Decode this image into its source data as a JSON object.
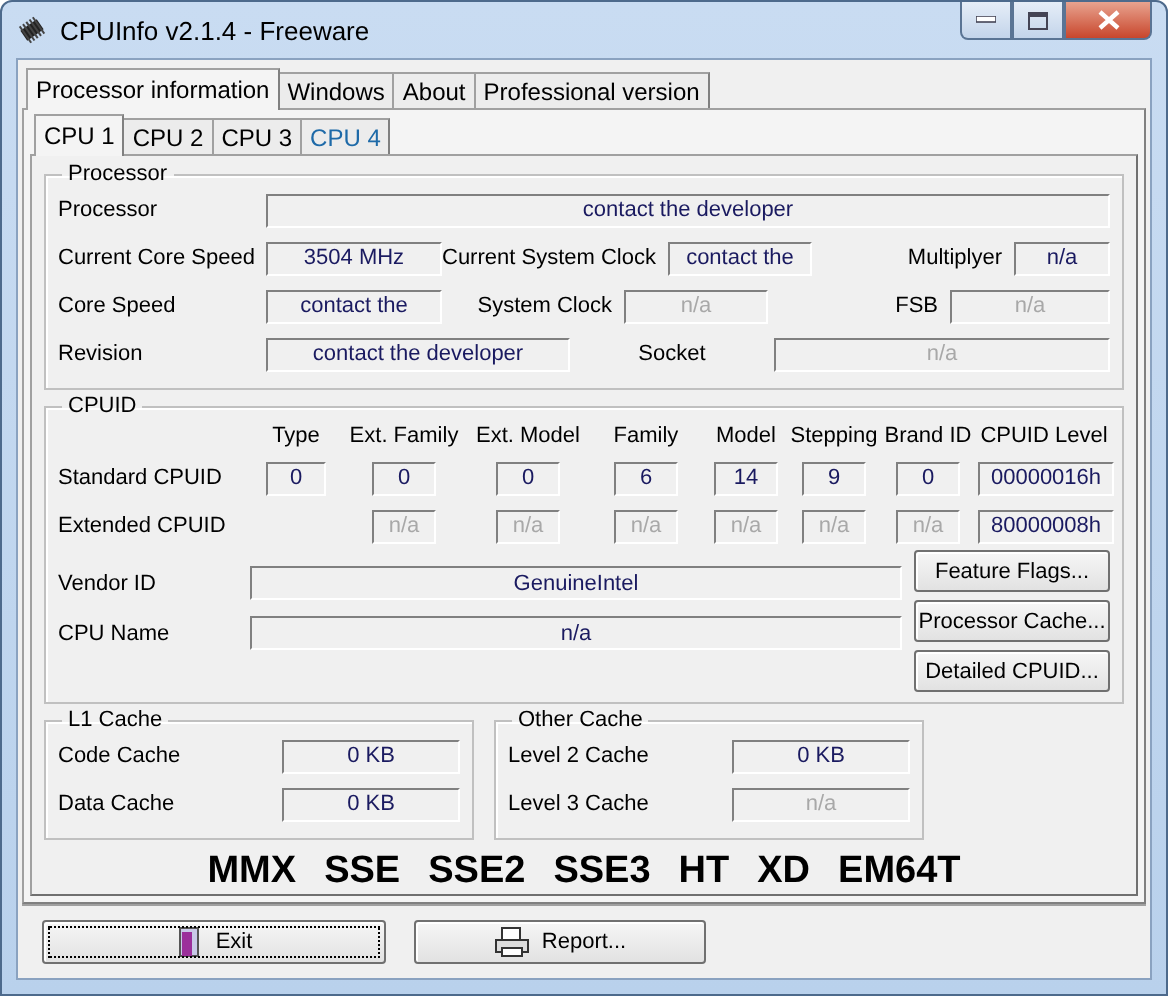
{
  "window": {
    "title": "CPUInfo v2.1.4 - Freeware"
  },
  "tabs": [
    {
      "label": "Processor information",
      "selected": true
    },
    {
      "label": "Windows",
      "selected": false
    },
    {
      "label": "About",
      "selected": false
    },
    {
      "label": "Professional version",
      "selected": false
    }
  ],
  "cpu_tabs": [
    {
      "label": "CPU 1",
      "selected": true,
      "hovered": false
    },
    {
      "label": "CPU 2",
      "selected": false,
      "hovered": false
    },
    {
      "label": "CPU 3",
      "selected": false,
      "hovered": false
    },
    {
      "label": "CPU 4",
      "selected": false,
      "hovered": true
    }
  ],
  "processor": {
    "title": "Processor",
    "rows": [
      [
        {
          "label": "Processor",
          "value": "contact the developer",
          "disabled": false
        }
      ],
      [
        {
          "label": "Current Core Speed",
          "value": "3504 MHz",
          "disabled": false
        },
        {
          "label": "Current System Clock",
          "value": "contact the",
          "disabled": false
        },
        {
          "label": "Multiplyer",
          "value": "n/a",
          "disabled": false
        }
      ],
      [
        {
          "label": "Core Speed",
          "value": "contact the",
          "disabled": false
        },
        {
          "label": "System Clock",
          "value": "n/a",
          "disabled": true
        },
        {
          "label": "FSB",
          "value": "n/a",
          "disabled": true
        }
      ],
      [
        {
          "label": "Revision",
          "value": "contact the developer",
          "disabled": false
        },
        {
          "label": "Socket",
          "value": "n/a",
          "disabled": true
        }
      ]
    ]
  },
  "cpuid": {
    "title": "CPUID",
    "columns": [
      "Type",
      "Ext. Family",
      "Ext. Model",
      "Family",
      "Model",
      "Stepping",
      "Brand ID",
      "CPUID Level"
    ],
    "rows": [
      {
        "label": "Standard CPUID",
        "values": [
          {
            "value": "0",
            "disabled": false
          },
          {
            "value": "0",
            "disabled": false
          },
          {
            "value": "0",
            "disabled": false
          },
          {
            "value": "6",
            "disabled": false
          },
          {
            "value": "14",
            "disabled": false
          },
          {
            "value": "9",
            "disabled": false
          },
          {
            "value": "0",
            "disabled": false
          },
          {
            "value": "00000016h",
            "disabled": false
          }
        ]
      },
      {
        "label": "Extended CPUID",
        "values": [
          {
            "value": "n/a",
            "disabled": true
          },
          {
            "value": "n/a",
            "disabled": true
          },
          {
            "value": "n/a",
            "disabled": true
          },
          {
            "value": "n/a",
            "disabled": true
          },
          {
            "value": "n/a",
            "disabled": true
          },
          {
            "value": "n/a",
            "disabled": true
          },
          {
            "value": "80000008h",
            "disabled": false
          }
        ]
      }
    ],
    "fields": [
      {
        "label": "Vendor ID",
        "value": "GenuineIntel",
        "disabled": false
      },
      {
        "label": "CPU Name",
        "value": "n/a",
        "disabled": false
      }
    ]
  },
  "side_buttons": [
    "Feature Flags...",
    "Processor Cache...",
    "Detailed CPUID..."
  ],
  "l1_cache": {
    "title": "L1 Cache",
    "fields": [
      {
        "label": "Code Cache",
        "value": "0 KB",
        "disabled": false
      },
      {
        "label": "Data Cache",
        "value": "0 KB",
        "disabled": false
      }
    ]
  },
  "other_cache": {
    "title": "Other Cache",
    "fields": [
      {
        "label": "Level 2 Cache",
        "value": "0 KB",
        "disabled": false
      },
      {
        "label": "Level 3 Cache",
        "value": "n/a",
        "disabled": true
      }
    ]
  },
  "flags": [
    {
      "label": "MMX",
      "supported": true
    },
    {
      "label": "SSE",
      "supported": true
    },
    {
      "label": "SSE2",
      "supported": true
    },
    {
      "label": "SSE3",
      "supported": true
    },
    {
      "label": "HT",
      "supported": true
    },
    {
      "label": "XD",
      "supported": true
    },
    {
      "label": "EM64T",
      "supported": true
    }
  ],
  "buttons": [
    {
      "label": "Exit",
      "kind": "exit",
      "focused": true
    },
    {
      "label": "Report...",
      "kind": "report",
      "focused": false
    }
  ]
}
